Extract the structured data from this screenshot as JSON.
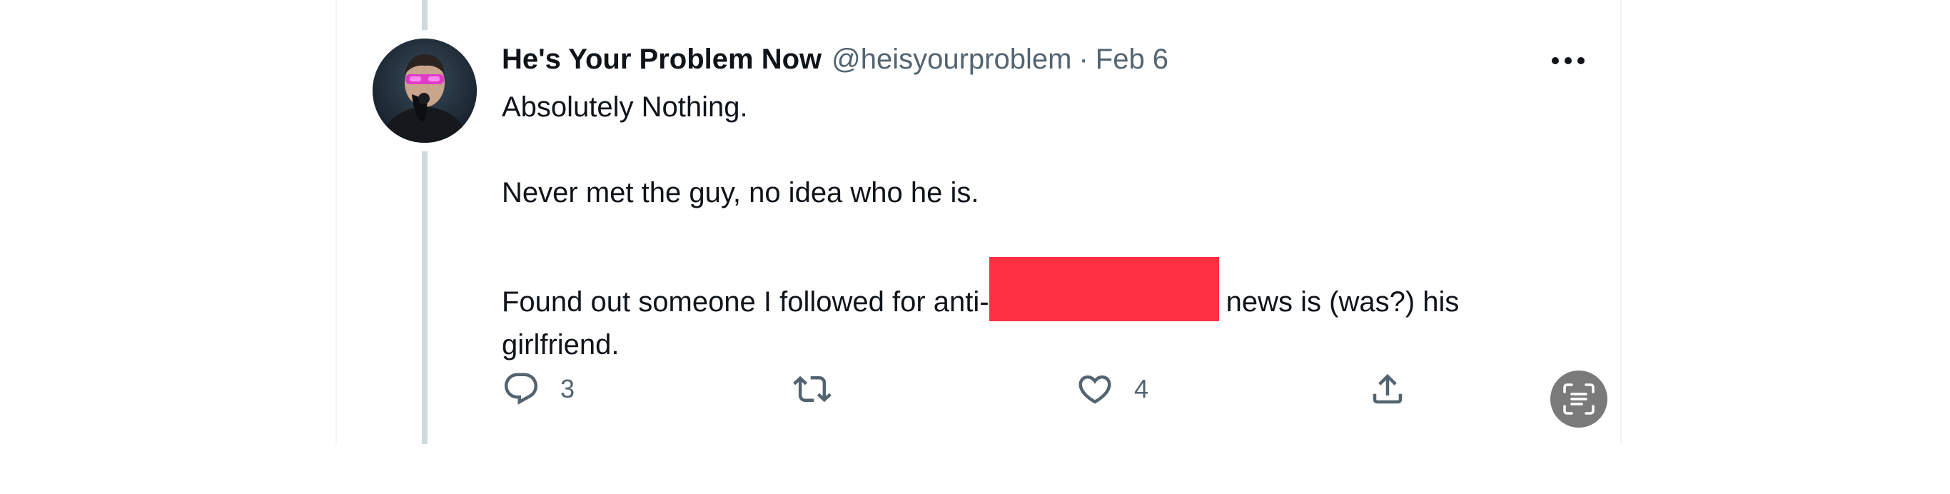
{
  "tweet": {
    "display_name": "He's Your Problem Now",
    "handle": "@heisyourproblem",
    "separator": "·",
    "date": "Feb 6",
    "body": {
      "line1": "Absolutely Nothing.",
      "line2": "Never met the guy, no idea who he is.",
      "line3_before_redaction": "Found out someone I followed for anti-",
      "line3_after_redaction": "news is (was?) his",
      "line4": "girlfriend."
    },
    "redaction_color": "#ff3041"
  },
  "actions": {
    "reply_icon": "reply-bubble-icon",
    "reply_count": "3",
    "retweet_icon": "retweet-icon",
    "retweet_count": "",
    "like_icon": "heart-icon",
    "like_count": "4",
    "share_icon": "share-upload-icon"
  },
  "overlay": {
    "text_capture_icon": "text-scan-icon"
  },
  "colors": {
    "text_primary": "#0f1419",
    "text_secondary": "#536471",
    "thread_line": "#cfd9de"
  }
}
